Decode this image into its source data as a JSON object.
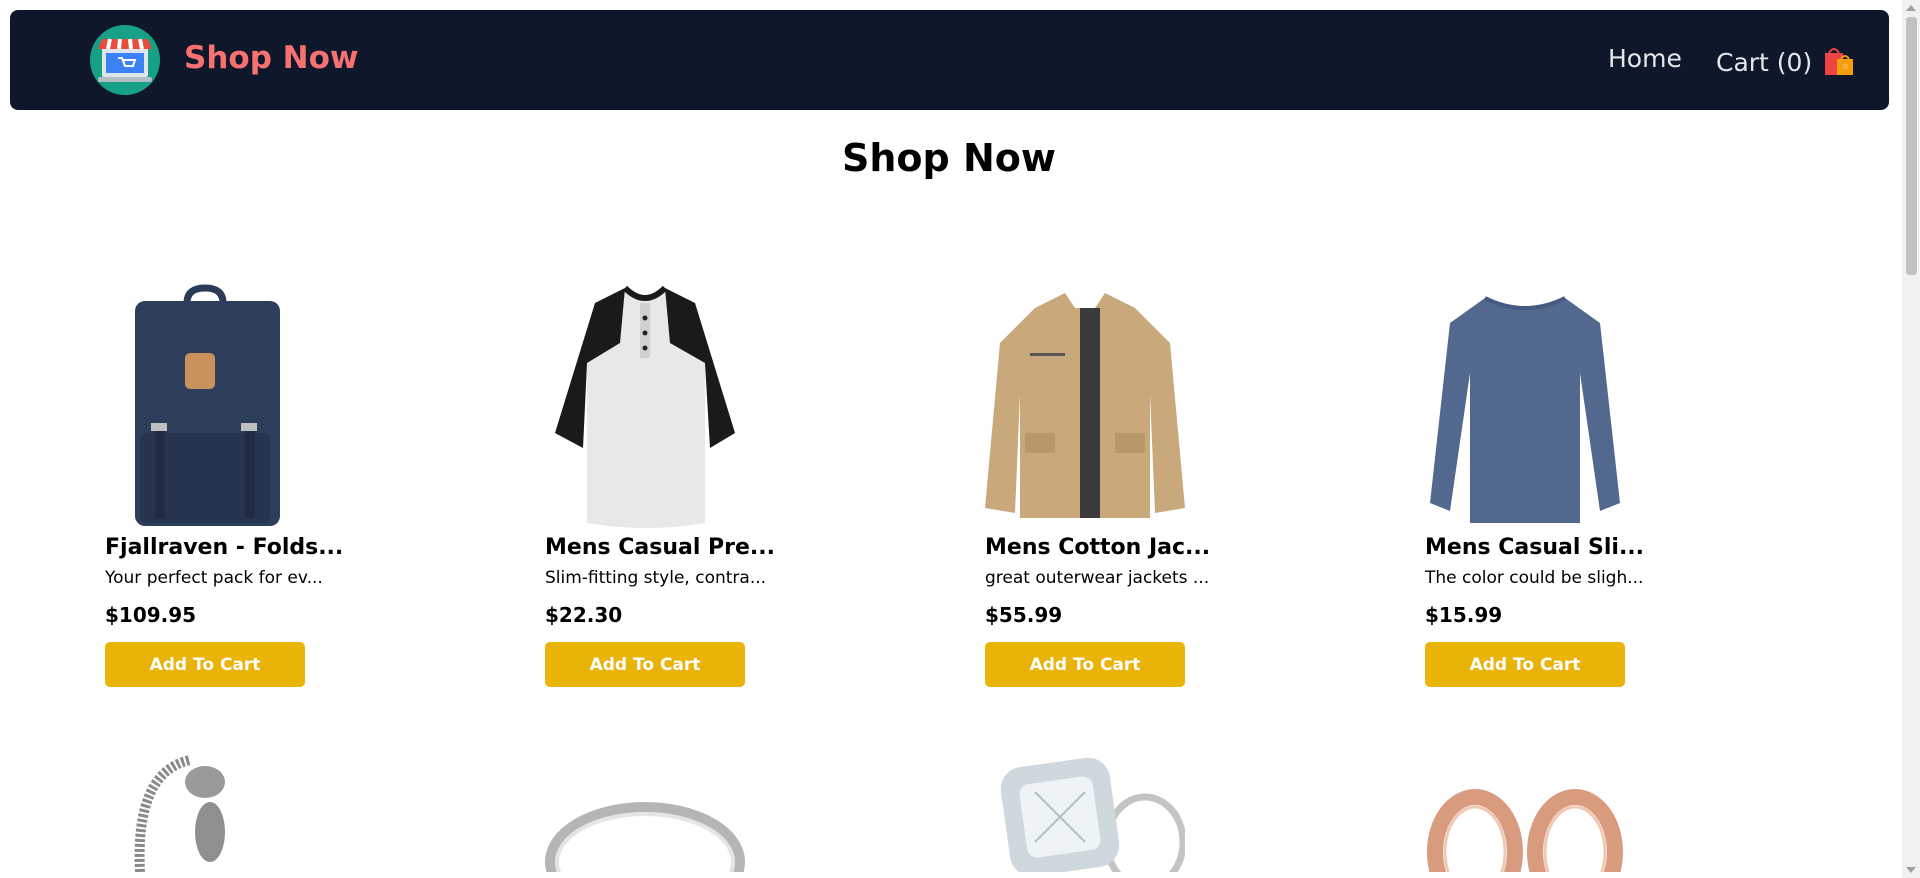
{
  "nav": {
    "brand": "Shop Now",
    "home": "Home",
    "cart": "Cart (0)"
  },
  "page": {
    "title": "Shop Now"
  },
  "products": [
    {
      "name": "Fjallraven - Folds...",
      "desc": "Your perfect pack for ev...",
      "price": "$109.95",
      "button": "Add To Cart",
      "image": "backpack-image"
    },
    {
      "name": "Mens Casual Pre...",
      "desc": "Slim-fitting style, contra...",
      "price": "$22.30",
      "button": "Add To Cart",
      "image": "raglan-tshirt-image"
    },
    {
      "name": "Mens Cotton Jac...",
      "desc": "great outerwear jackets ...",
      "price": "$55.99",
      "button": "Add To Cart",
      "image": "cotton-jacket-image"
    },
    {
      "name": "Mens Casual Sli...",
      "desc": "The color could be sligh...",
      "price": "$15.99",
      "button": "Add To Cart",
      "image": "longsleeve-tshirt-image"
    }
  ],
  "second_row_images": [
    "bracelet-image",
    "silver-ring-image",
    "diamond-ring-image",
    "rose-gold-rings-image"
  ],
  "colors": {
    "navbar": "#0f172a",
    "brand": "#f87171",
    "button": "#eab308"
  }
}
